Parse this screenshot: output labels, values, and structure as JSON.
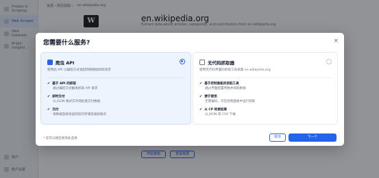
{
  "background": {
    "breadcrumb": [
      "资源 › 网页抓取 ›",
      "en.wikipedia.org"
    ],
    "sidebar": {
      "items": [
        "Proxies & Scraping",
        "Web Scraper",
        "Web Datasets",
        "Bright Insights"
      ],
      "bottom": [
        "账户",
        "账户设置"
      ]
    },
    "site_logo": "W",
    "site_title": "en.wikipedia.org",
    "site_desc": "Extract data about articles, categories, and contributors from en.wikipedia.org",
    "buttons": [
      "开始使用",
      "查看数据"
    ]
  },
  "modal": {
    "title": "您需要什么服务?",
    "close_icon": "×",
    "options": [
      {
        "title": "爬虫 API",
        "icon": "api-icon",
        "selected": true,
        "desc": "使用此 API 以编程方式发起网络数据抓取请求",
        "features": [
          {
            "title": "基于 API 的抓取",
            "desc": "通过编程方式触发抓取 API 请求"
          },
          {
            "title": "即时交付",
            "desc": "以 JSON 格式实时或批量交付数据"
          },
          {
            "title": "交付",
            "desc": "将数据直接发送到您的存储或通知端点"
          }
        ]
      },
      {
        "title": "无代码抓取器",
        "icon": "no-code-icon",
        "selected": false,
        "desc": "使用无代码界面的抓取工具采集 en.wikipedia.org",
        "features": [
          {
            "title": "基于控制面板的抓取工具",
            "desc": "通过界面配置参数并抓取数据"
          },
          {
            "title": "便于使用",
            "desc": "无需编码，可在控制面板中运行抓取"
          },
          {
            "title": "从 CP 检索结果",
            "desc": "以 JSON 或 CSV 下载"
          }
        ]
      }
    ],
    "footer_note": "* 您可以稍后更改此选择",
    "cancel_label": "取消",
    "next_label": "下一个"
  }
}
